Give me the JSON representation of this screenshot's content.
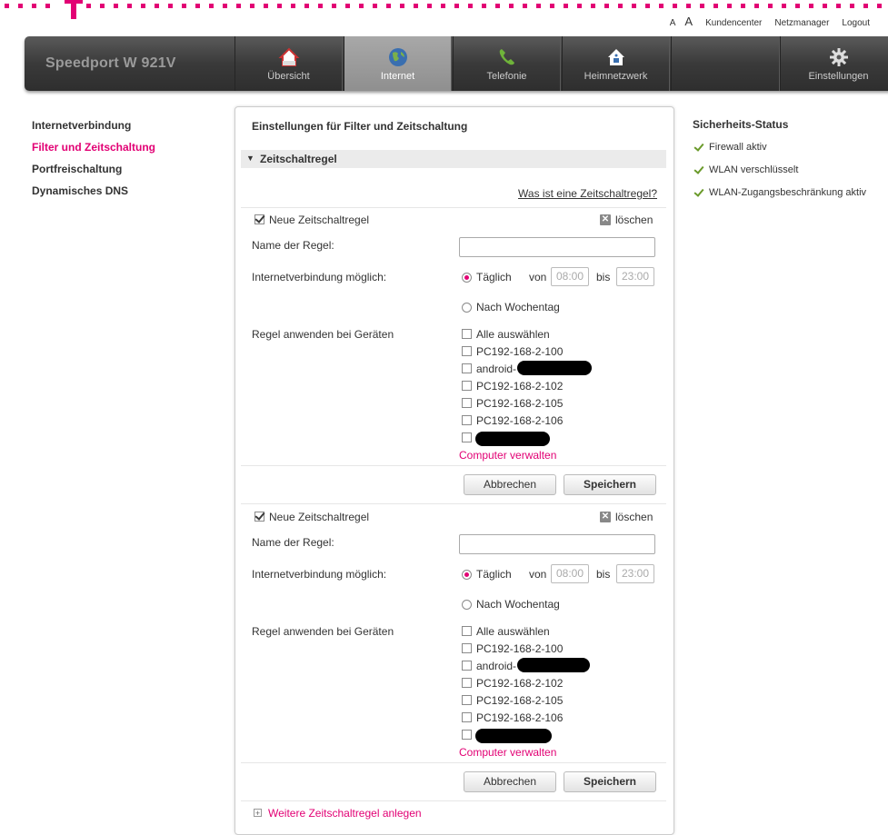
{
  "brand": {
    "logo_color": "#e20074",
    "accent": "#e20074"
  },
  "toplinks": {
    "font_small": "A",
    "font_large": "A",
    "kundencenter": "Kundencenter",
    "netzmanager": "Netzmanager",
    "logout": "Logout"
  },
  "navbar": {
    "device_name": "Speedport W 921V",
    "items": [
      {
        "label": "Übersicht",
        "icon": "house-icon"
      },
      {
        "label": "Internet",
        "icon": "globe-icon",
        "active": true
      },
      {
        "label": "Telefonie",
        "icon": "phone-icon"
      },
      {
        "label": "Heimnetzwerk",
        "icon": "home-network-icon"
      },
      {
        "label": "Einstellungen",
        "icon": "gear-icon"
      }
    ]
  },
  "leftnav": {
    "items": [
      {
        "label": "Internetverbindung"
      },
      {
        "label": "Filter und Zeitschaltung",
        "selected": true
      },
      {
        "label": "Portfreischaltung"
      },
      {
        "label": "Dynamisches DNS"
      }
    ]
  },
  "main": {
    "title": "Einstellungen für Filter und Zeitschaltung",
    "section_title": "Zeitschaltregel",
    "help_link": "Was ist eine Zeitschaltregel?",
    "rules": [
      {
        "title": "Neue Zeitschaltregel",
        "delete_label": "löschen",
        "name_label": "Name der Regel:",
        "name_value": "",
        "connection_label": "Internetverbindung möglich:",
        "daily_label": "Täglich",
        "from_label": "von",
        "from_value": "08:00",
        "to_label": "bis",
        "to_value": "23:00",
        "weekday_label": "Nach Wochentag",
        "devices_label": "Regel anwenden bei Geräten",
        "select_all": "Alle auswählen",
        "devices": [
          "PC192-168-2-100",
          "android-",
          "PC192-168-2-102",
          "PC192-168-2-105",
          "PC192-168-2-106",
          ""
        ],
        "manage_link": "Computer verwalten",
        "cancel": "Abbrechen",
        "save": "Speichern"
      },
      {
        "title": "Neue Zeitschaltregel",
        "delete_label": "löschen",
        "name_label": "Name der Regel:",
        "name_value": "",
        "connection_label": "Internetverbindung möglich:",
        "daily_label": "Täglich",
        "from_label": "von",
        "from_value": "08:00",
        "to_label": "bis",
        "to_value": "23:00",
        "weekday_label": "Nach Wochentag",
        "devices_label": "Regel anwenden bei Geräten",
        "select_all": "Alle auswählen",
        "devices": [
          "PC192-168-2-100",
          "android-",
          "PC192-168-2-102",
          "PC192-168-2-105",
          "PC192-168-2-106",
          ""
        ],
        "manage_link": "Computer verwalten",
        "cancel": "Abbrechen",
        "save": "Speichern"
      }
    ],
    "add_rule": "Weitere Zeitschaltregel anlegen"
  },
  "status": {
    "title": "Sicherheits-Status",
    "items": [
      "Firewall aktiv",
      "WLAN verschlüsselt",
      "WLAN-Zugangsbeschränkung aktiv"
    ]
  }
}
